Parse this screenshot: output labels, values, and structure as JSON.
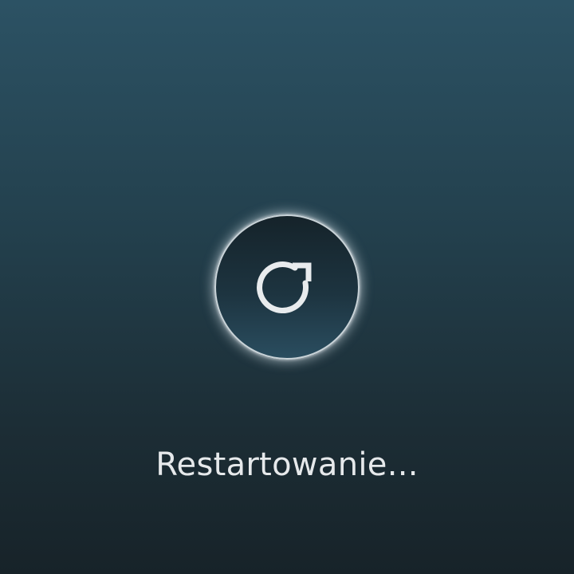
{
  "status": {
    "message": "Restartowanie..."
  },
  "icon": {
    "name": "restart-icon",
    "color": "#e8ebed"
  },
  "colors": {
    "background_top": "#2c5264",
    "background_bottom": "#172329",
    "circle_border": "#c9d3d8"
  }
}
